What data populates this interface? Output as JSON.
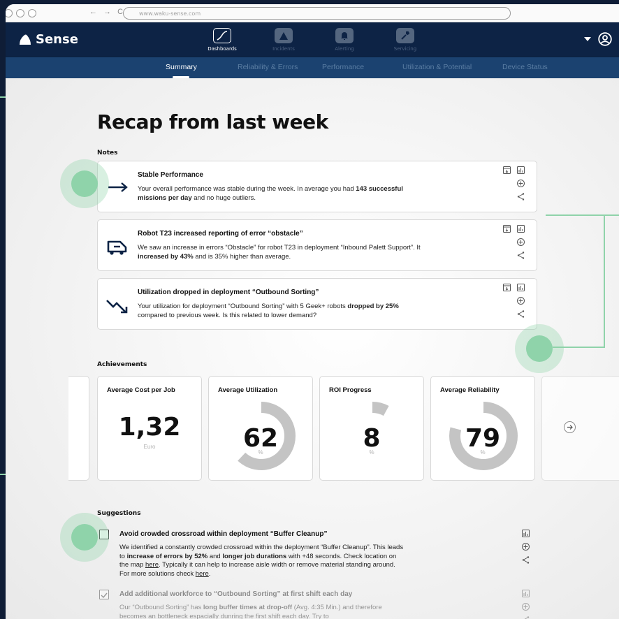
{
  "browser": {
    "url": "www.waku-sense.com",
    "nav": "← → C"
  },
  "app": {
    "name": "Sense"
  },
  "nav": {
    "items": [
      {
        "label": "Dashboards",
        "icon": "chart-line-icon",
        "active": true
      },
      {
        "label": "Incidents",
        "icon": "warning-icon",
        "active": false
      },
      {
        "label": "Alerting",
        "icon": "bell-icon",
        "active": false
      },
      {
        "label": "Servicing",
        "icon": "wrench-icon",
        "active": false
      }
    ]
  },
  "subnav": {
    "tabs": [
      {
        "label": "Summary",
        "active": true
      },
      {
        "label": "Reliability & Errors"
      },
      {
        "label": "Performance"
      },
      {
        "label": "Utilization & Potential"
      },
      {
        "label": "Device Status"
      }
    ]
  },
  "page": {
    "title": "Recap from last week"
  },
  "notes": {
    "heading": "Notes",
    "items": [
      {
        "title": "Stable Performance",
        "text_a": "Your overall performance was stable during the week. In average you had ",
        "bold_a": "143 successful missions per day",
        "text_b": " and no huge outliers.",
        "icon": "arrow-right-icon"
      },
      {
        "title": "Robot T23 increased reporting of error “obstacle”",
        "text_a": "We saw an increase in errors “Obstacle” for robot T23 in deployment “Inbound Palett Support”. It ",
        "bold_a": "increased by 43%",
        "text_b": " and is 35% higher than average.",
        "icon": "robot-icon"
      },
      {
        "title": "Utilization dropped in deployment “Outbound Sorting”",
        "text_a": "Your utilization for deployment “Outbound Sorting” with 5 Geek+ robots ",
        "bold_a": "dropped by 25%",
        "text_b": " compared to previous week. Is this related to lower demand?",
        "icon": "trend-down-icon"
      }
    ]
  },
  "achievements": {
    "heading": "Achievements",
    "cards": [
      {
        "title": "Average Cost per Job",
        "value": "1,32",
        "unit": "Euro"
      },
      {
        "title": "Average Utilization",
        "value": "62",
        "unit": "%",
        "fraction": 0.62
      },
      {
        "title": "ROI Progress",
        "value": "8",
        "unit": "%",
        "fraction": 0.08
      },
      {
        "title": "Average Reliability",
        "value": "79",
        "unit": "%",
        "fraction": 0.79
      }
    ]
  },
  "suggestions": {
    "heading": "Suggestions",
    "items": [
      {
        "title": "Avoid crowded crossroad within deployment “Buffer Cleanup”",
        "checked": false,
        "t1": "We identified a constantly crowded crossroad within the deployment “Buffer Cleanup”. This leads to ",
        "b1": "increase of errors by 52%",
        "t2": " and ",
        "b2": "longer job durations",
        "t3": " with +48 seconds. Check location on the map ",
        "l1": "here",
        "t4": ". Typically it can help to increase aisle width or remove material standing around. For more solutions check ",
        "l2": "here",
        "t5": "."
      },
      {
        "title": "Add additional workforce to “Outbound Sorting” at first shift each day",
        "checked": true,
        "t1": "Our “Outbound Sorting” has ",
        "b1": "long buffer times at drop-off",
        "t2": " (Avg. 4:35 Min.) and therefore becomes an bottleneck espacially dunring the first shift each day. Try to"
      }
    ]
  },
  "colors": {
    "navy": "#0d2345",
    "subnav": "#1b4270",
    "accent": "#8fd3aa",
    "ring": "#c4c4c4"
  }
}
